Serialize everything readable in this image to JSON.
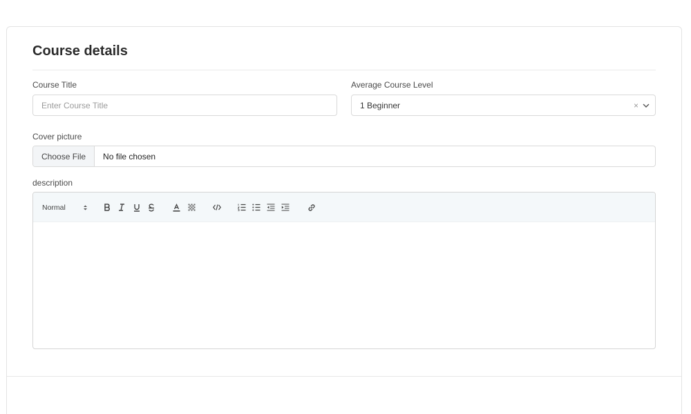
{
  "form": {
    "title": "Course details",
    "course_title": {
      "label": "Course Title",
      "value": "",
      "placeholder": "Enter Course Title"
    },
    "course_level": {
      "label": "Average Course Level",
      "selected": "1 Beginner",
      "clear_glyph": "×"
    },
    "cover_picture": {
      "label": "Cover picture",
      "button_label": "Choose File",
      "file_name": "No file chosen"
    },
    "description": {
      "label": "description",
      "header_select": "Normal",
      "toolbar_icons": [
        "header-select-arrows-icon",
        "bold-icon",
        "italic-icon",
        "underline-icon",
        "strikethrough-icon",
        "text-color-icon",
        "background-color-icon",
        "code-icon",
        "ordered-list-icon",
        "bullet-list-icon",
        "outdent-icon",
        "indent-icon",
        "link-icon"
      ]
    }
  },
  "colors": {
    "toolbar_bg": "#f4f8fa",
    "border": "#d9d9d9",
    "file_button_bg": "#f3f5f7"
  }
}
